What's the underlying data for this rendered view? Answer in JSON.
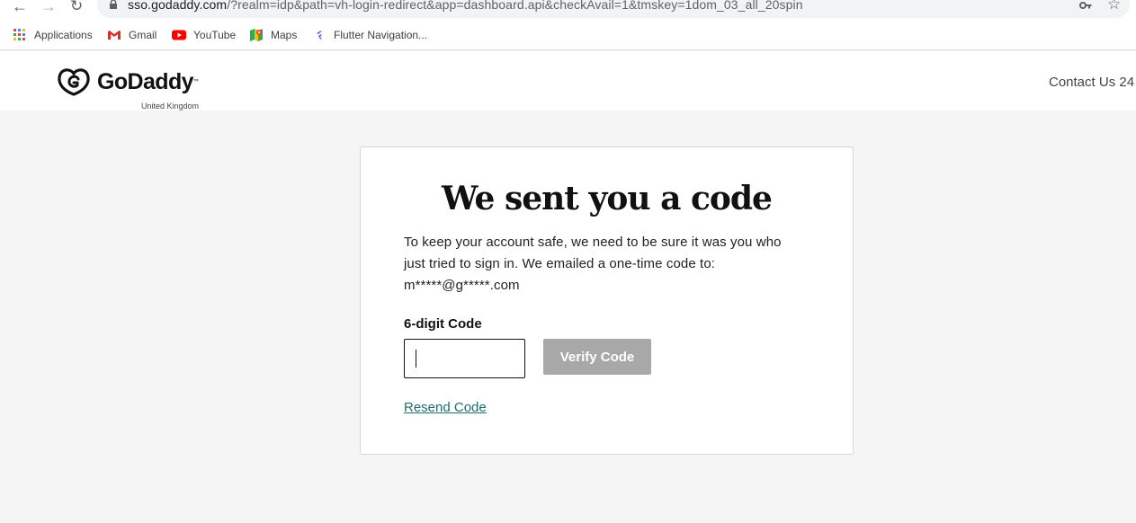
{
  "browser": {
    "url_host": "sso.godaddy.com",
    "url_rest": "/?realm=idp&path=vh-login-redirect&app=dashboard.api&checkAvail=1&tmskey=1dom_03_all_20spin",
    "bookmarks": [
      {
        "label": "Applications",
        "icon": "apps-grid-icon"
      },
      {
        "label": "Gmail",
        "icon": "gmail-icon"
      },
      {
        "label": "YouTube",
        "icon": "youtube-icon"
      },
      {
        "label": "Maps",
        "icon": "maps-icon"
      },
      {
        "label": "Flutter Navigation...",
        "icon": "flutter-icon"
      }
    ]
  },
  "header": {
    "logo_text": "GoDaddy",
    "region": "United Kingdom",
    "contact": "Contact Us 24"
  },
  "card": {
    "title": "We sent you a code",
    "body_line1": "To keep your account safe, we need to be sure it was you who",
    "body_line2": "just tried to sign in. We emailed a one-time code to:",
    "email": "m*****@g*****.com",
    "field_label": "6-digit Code",
    "input_value": "",
    "verify_label": "Verify Code",
    "resend_label": "Resend Code"
  },
  "colors": {
    "verify_disabled": "#a8a8a8",
    "link": "#1e6d6d",
    "page_bg": "#f5f5f5"
  }
}
